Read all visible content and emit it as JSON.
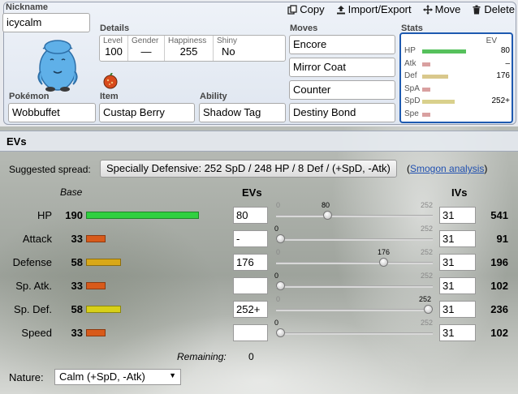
{
  "toolbar": {
    "copy": "Copy",
    "import_export": "Import/Export",
    "move": "Move",
    "delete": "Delete"
  },
  "set": {
    "nickname_label": "Nickname",
    "nickname": "icycalm",
    "details_label": "Details",
    "level_label": "Level",
    "level": "100",
    "gender_label": "Gender",
    "gender": "—",
    "happiness_label": "Happiness",
    "happiness": "255",
    "shiny_label": "Shiny",
    "shiny": "No",
    "pokemon_label": "Pokémon",
    "pokemon": "Wobbuffet",
    "item_label": "Item",
    "item": "Custap Berry",
    "ability_label": "Ability",
    "ability": "Shadow Tag",
    "moves_label": "Moves",
    "moves": [
      "Encore",
      "Mirror Coat",
      "Counter",
      "Destiny Bond"
    ],
    "stats_label": "Stats",
    "stats_ev_header": "EV",
    "stats": [
      {
        "name": "HP",
        "ev": "80",
        "fill": 0.75,
        "color": "#56c15c"
      },
      {
        "name": "Atk",
        "ev": "–",
        "fill": 0.14,
        "color": "#d9a0a0"
      },
      {
        "name": "Def",
        "ev": "176",
        "fill": 0.44,
        "color": "#d9c88c"
      },
      {
        "name": "SpA",
        "ev": "",
        "fill": 0.14,
        "color": "#d9a0a0"
      },
      {
        "name": "SpD",
        "ev": "252+",
        "fill": 0.56,
        "color": "#d9d08c"
      },
      {
        "name": "Spe",
        "ev": "",
        "fill": 0.14,
        "color": "#d9a0a0"
      }
    ]
  },
  "evs": {
    "heading": "EVs",
    "suggested_label": "Suggested spread:",
    "suggested_value": "Specially Defensive: 252 SpD / 248 HP / 8 Def / (+SpD, -Atk)",
    "smogon_prefix": "(",
    "smogon_link": "Smogon analysis",
    "smogon_suffix": ")",
    "col_base": "Base",
    "col_evs": "EVs",
    "col_ivs": "IVs",
    "slider_min": "0",
    "slider_max": "252",
    "rows": [
      {
        "name": "HP",
        "base": "190",
        "base_fraction": 0.74,
        "color": "#30d040",
        "ev": "80",
        "ev_num": 80,
        "iv": "31",
        "total": "541"
      },
      {
        "name": "Attack",
        "base": "33",
        "base_fraction": 0.13,
        "color": "#d85a1a",
        "ev": "-",
        "ev_num": 0,
        "iv": "31",
        "total": "91"
      },
      {
        "name": "Defense",
        "base": "58",
        "base_fraction": 0.23,
        "color": "#d8a818",
        "ev": "176",
        "ev_num": 176,
        "iv": "31",
        "total": "196"
      },
      {
        "name": "Sp. Atk.",
        "base": "33",
        "base_fraction": 0.13,
        "color": "#d85a1a",
        "ev": "",
        "ev_num": 0,
        "iv": "31",
        "total": "102"
      },
      {
        "name": "Sp. Def.",
        "base": "58",
        "base_fraction": 0.23,
        "color": "#d8d018",
        "ev": "252+",
        "ev_num": 252,
        "iv": "31",
        "total": "236"
      },
      {
        "name": "Speed",
        "base": "33",
        "base_fraction": 0.13,
        "color": "#d85a1a",
        "ev": "",
        "ev_num": 0,
        "iv": "31",
        "total": "102"
      }
    ],
    "remaining_label": "Remaining:",
    "remaining_value": "0",
    "nature_label": "Nature:",
    "nature_value": "Calm (+SpD, -Atk)"
  }
}
